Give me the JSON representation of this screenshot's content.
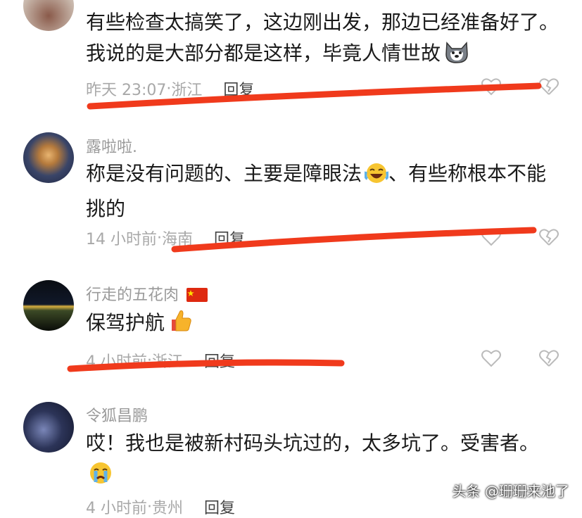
{
  "comments": [
    {
      "username": "",
      "text": "有些检查太搞笑了，这边刚出发，那边已经准备好了。我说的是大部分都是这样，毕竟人情世故",
      "time": "昨天 23:07",
      "location": "浙江",
      "reply_label": "回复",
      "emoji": "husky-dog-emoji"
    },
    {
      "username": "露啦啦.",
      "text": "称是没有问题的、主要是障眼法",
      "text_tail": "、有些称根本不能挑的",
      "time": "14 小时前",
      "location": "海南",
      "reply_label": "回复",
      "emoji": "laughing-tears-emoji"
    },
    {
      "username": "行走的五花肉",
      "text": "保驾护航",
      "time": "4 小时前",
      "location": "浙江",
      "reply_label": "回复",
      "emoji": "thumbs-up-emoji",
      "badge_icon": "china-flag-icon"
    },
    {
      "username": "令狐昌鹏",
      "text": "哎！我也是被新村码头坑过的，太多坑了。受害者。",
      "time": "4 小时前",
      "location": "贵州",
      "reply_label": "回复",
      "emoji": "crying-face-emoji"
    }
  ],
  "separator": " · ",
  "watermark": "头条 @珊珊来池了",
  "colors": {
    "annotation_red": "#f03a1c",
    "meta_gray": "#a8a8a8",
    "text": "#1a1a1a"
  }
}
